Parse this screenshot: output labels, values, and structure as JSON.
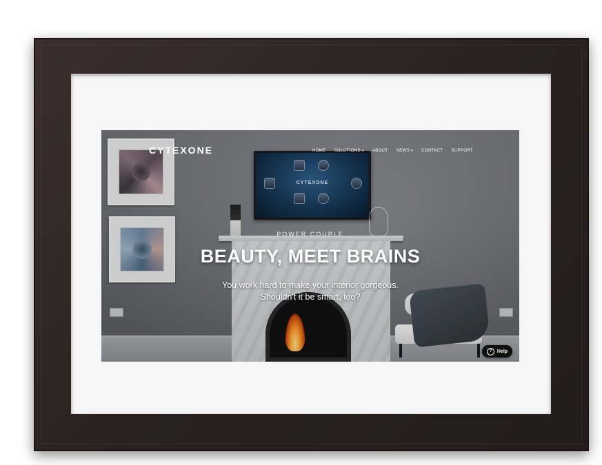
{
  "site": {
    "logo": "CYTEXONE",
    "nav": [
      {
        "label": "HOME",
        "has_dropdown": false
      },
      {
        "label": "SOLUTIONS",
        "has_dropdown": true
      },
      {
        "label": "ABOUT",
        "has_dropdown": false
      },
      {
        "label": "NEWS",
        "has_dropdown": true
      },
      {
        "label": "CONTACT",
        "has_dropdown": false
      },
      {
        "label": "SUPPORT",
        "has_dropdown": false
      }
    ],
    "hero": {
      "eyebrow": "POWER COUPLE",
      "headline": "BEAUTY, MEET BRAINS",
      "subline_1": "You work hard to make your interior gorgeous.",
      "subline_2": "Shouldn't it be smart, too?"
    },
    "tv_screen_brand": "CYTEXONE",
    "help_button": {
      "label": "Help",
      "icon": "question-circle-icon"
    }
  },
  "colors": {
    "frame": "#2b2220",
    "mat": "#f6f6f6",
    "help_bg": "#0f0f10",
    "text_light": "#ffffff"
  }
}
